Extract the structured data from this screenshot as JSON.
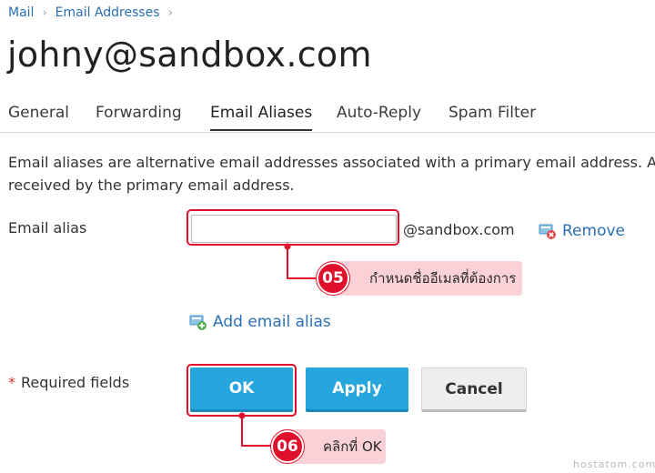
{
  "breadcrumb": {
    "items": [
      "Mail",
      "Email Addresses"
    ]
  },
  "page": {
    "title": "johny@sandbox.com"
  },
  "tabs": [
    {
      "label": "General",
      "active": false
    },
    {
      "label": "Forwarding",
      "active": false
    },
    {
      "label": "Email Aliases",
      "active": true
    },
    {
      "label": "Auto-Reply",
      "active": false
    },
    {
      "label": "Spam Filter",
      "active": false
    }
  ],
  "description": {
    "line1": "Email aliases are alternative email addresses associated with a primary email address. A",
    "line2": "received by the primary email address."
  },
  "form": {
    "alias_label": "Email alias",
    "alias_value": "",
    "alias_placeholder": "",
    "domain_suffix": "@sandbox.com",
    "remove_label": "Remove",
    "add_alias_label": "Add email alias",
    "required_star": "*",
    "required_label": "Required fields"
  },
  "buttons": {
    "ok": "OK",
    "apply": "Apply",
    "cancel": "Cancel"
  },
  "callouts": [
    {
      "number": "05",
      "text": "กำหนดชื่ออีเมลที่ต้องการ"
    },
    {
      "number": "06",
      "text": "คลิกที่ OK"
    }
  ],
  "watermark": "hostatom.com",
  "colors": {
    "link": "#2a6fb5",
    "primary_button": "#27a5dd",
    "annotation_red": "#e0102a",
    "callout_pink": "#fad1d6"
  },
  "icons": {
    "breadcrumb_separator": "chevron-right-icon",
    "remove": "remove-alias-icon",
    "add": "add-alias-icon"
  }
}
